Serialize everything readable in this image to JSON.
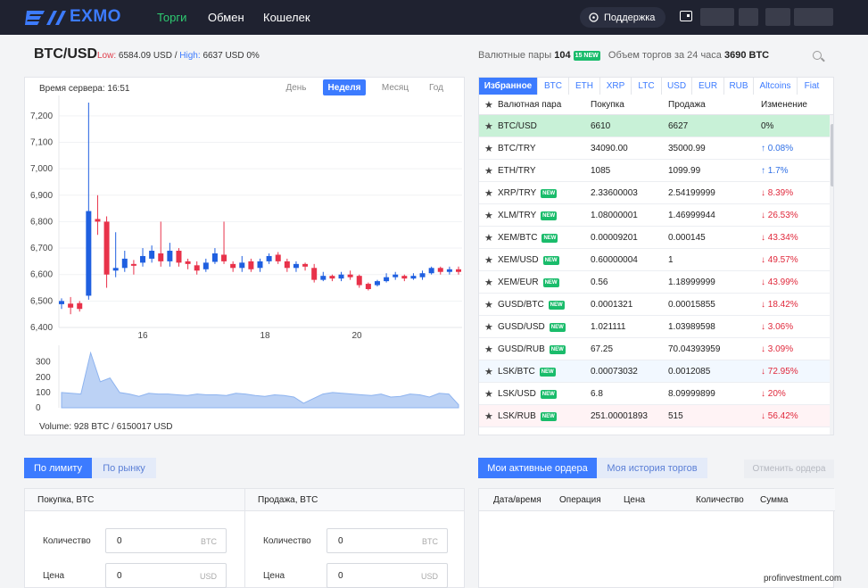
{
  "header": {
    "logo_text": "EXMO",
    "nav": [
      "Торги",
      "Обмен",
      "Кошелек"
    ],
    "support_label": "Поддержка"
  },
  "pair": {
    "title": "BTC/USD",
    "low_label": "Low:",
    "low_value": "6584.09 USD /",
    "high_label": "High:",
    "high_value": "6637 USD 0%"
  },
  "market": {
    "pairs_label": "Валютные пары",
    "pairs_count": "104",
    "new_badge": "15 NEW",
    "volume_label": "Объем торгов за 24 часа",
    "volume_value": "3690 BTC"
  },
  "chart": {
    "server_time": "Время сервера: 16:51",
    "ranges": [
      "День",
      "Неделя",
      "Месяц",
      "Год"
    ],
    "active_range": "Неделя",
    "volume_text": "Volume: 928 BTC / 6150017 USD"
  },
  "chart_data": {
    "type": "candlestick",
    "title": "",
    "price_axis": {
      "ticks": [
        7200,
        7100,
        7000,
        6900,
        6800,
        6700,
        6600,
        6500,
        6400
      ],
      "range": [
        6400,
        7250
      ]
    },
    "x_ticks": [
      "16",
      "18",
      "20"
    ],
    "candles": [
      [
        6488,
        6500,
        6470,
        6510
      ],
      [
        6490,
        6475,
        6450,
        6515
      ],
      [
        6492,
        6470,
        6460,
        6500
      ],
      [
        6520,
        6840,
        6505,
        7250
      ],
      [
        6810,
        6800,
        6750,
        6900
      ],
      [
        6800,
        6600,
        6550,
        6820
      ],
      [
        6615,
        6625,
        6590,
        6760
      ],
      [
        6625,
        6660,
        6610,
        6690
      ],
      [
        6640,
        6635,
        6600,
        6655
      ],
      [
        6645,
        6670,
        6630,
        6700
      ],
      [
        6660,
        6690,
        6645,
        6710
      ],
      [
        6680,
        6650,
        6630,
        6800
      ],
      [
        6650,
        6690,
        6630,
        6720
      ],
      [
        6690,
        6645,
        6630,
        6700
      ],
      [
        6650,
        6640,
        6620,
        6660
      ],
      [
        6635,
        6615,
        6600,
        6650
      ],
      [
        6620,
        6645,
        6610,
        6660
      ],
      [
        6648,
        6680,
        6640,
        6700
      ],
      [
        6675,
        6650,
        6640,
        6800
      ],
      [
        6640,
        6625,
        6610,
        6650
      ],
      [
        6625,
        6645,
        6610,
        6670
      ],
      [
        6650,
        6620,
        6610,
        6660
      ],
      [
        6625,
        6650,
        6610,
        6660
      ],
      [
        6650,
        6670,
        6640,
        6680
      ],
      [
        6675,
        6650,
        6640,
        6685
      ],
      [
        6650,
        6625,
        6610,
        6660
      ],
      [
        6625,
        6640,
        6610,
        6650
      ],
      [
        6640,
        6630,
        6615,
        6645
      ],
      [
        6625,
        6580,
        6570,
        6640
      ],
      [
        6580,
        6595,
        6575,
        6610
      ],
      [
        6595,
        6585,
        6575,
        6600
      ],
      [
        6585,
        6600,
        6575,
        6610
      ],
      [
        6600,
        6590,
        6580,
        6615
      ],
      [
        6595,
        6560,
        6550,
        6600
      ],
      [
        6565,
        6545,
        6540,
        6570
      ],
      [
        6560,
        6575,
        6555,
        6580
      ],
      [
        6575,
        6590,
        6570,
        6605
      ],
      [
        6590,
        6600,
        6580,
        6610
      ],
      [
        6595,
        6585,
        6575,
        6600
      ],
      [
        6585,
        6595,
        6580,
        6605
      ],
      [
        6590,
        6605,
        6580,
        6615
      ],
      [
        6605,
        6625,
        6600,
        6630
      ],
      [
        6625,
        6610,
        6600,
        6630
      ],
      [
        6610,
        6620,
        6600,
        6630
      ],
      [
        6620,
        6610,
        6600,
        6630
      ]
    ],
    "volume_axis": {
      "ticks": [
        300,
        200,
        100,
        0
      ],
      "range": [
        0,
        380
      ]
    },
    "volume_series": [
      100,
      95,
      90,
      360,
      170,
      195,
      100,
      90,
      75,
      95,
      90,
      90,
      85,
      80,
      90,
      85,
      85,
      80,
      95,
      90,
      80,
      75,
      85,
      80,
      70,
      30,
      60,
      90,
      100,
      95,
      90,
      85,
      80,
      90,
      70,
      75,
      90,
      85,
      70,
      95,
      90,
      20
    ],
    "colors": {
      "up": "#1f5fe0",
      "down": "#e8324a",
      "volume_fill": "#bcd2f5",
      "volume_line": "#8db3ef"
    }
  },
  "pairs": {
    "tabs": [
      "Избранное",
      "BTC",
      "ETH",
      "XRP",
      "LTC",
      "USD",
      "EUR",
      "RUB",
      "Altcoins",
      "Fiat"
    ],
    "active_tab": "Избранное",
    "columns": [
      "Валютная пара",
      "Покупка",
      "Продажа",
      "Изменение"
    ],
    "new_tag": "NEW",
    "rows": [
      {
        "pair": "BTC/USD",
        "new": false,
        "buy": "6610",
        "sell": "6627",
        "change": "0%",
        "dir": "flat",
        "bg": "selected"
      },
      {
        "pair": "BTC/TRY",
        "new": false,
        "buy": "34090.00",
        "sell": "35000.99",
        "change": "↑ 0.08%",
        "dir": "up",
        "bg": ""
      },
      {
        "pair": "ETH/TRY",
        "new": false,
        "buy": "1085",
        "sell": "1099.99",
        "change": "↑ 1.7%",
        "dir": "up",
        "bg": ""
      },
      {
        "pair": "XRP/TRY",
        "new": true,
        "buy": "2.33600003",
        "sell": "2.54199999",
        "change": "↓ 8.39%",
        "dir": "down",
        "bg": ""
      },
      {
        "pair": "XLM/TRY",
        "new": true,
        "buy": "1.08000001",
        "sell": "1.46999944",
        "change": "↓ 26.53%",
        "dir": "down",
        "bg": ""
      },
      {
        "pair": "XEM/BTC",
        "new": true,
        "buy": "0.00009201",
        "sell": "0.000145",
        "change": "↓ 43.34%",
        "dir": "down",
        "bg": ""
      },
      {
        "pair": "XEM/USD",
        "new": true,
        "buy": "0.60000004",
        "sell": "1",
        "change": "↓ 49.57%",
        "dir": "down",
        "bg": ""
      },
      {
        "pair": "XEM/EUR",
        "new": true,
        "buy": "0.56",
        "sell": "1.18999999",
        "change": "↓ 43.99%",
        "dir": "down",
        "bg": ""
      },
      {
        "pair": "GUSD/BTC",
        "new": true,
        "buy": "0.0001321",
        "sell": "0.00015855",
        "change": "↓ 18.42%",
        "dir": "down",
        "bg": ""
      },
      {
        "pair": "GUSD/USD",
        "new": true,
        "buy": "1.021111",
        "sell": "1.03989598",
        "change": "↓ 3.06%",
        "dir": "down",
        "bg": ""
      },
      {
        "pair": "GUSD/RUB",
        "new": true,
        "buy": "67.25",
        "sell": "70.04393959",
        "change": "↓ 3.09%",
        "dir": "down",
        "bg": ""
      },
      {
        "pair": "LSK/BTC",
        "new": true,
        "buy": "0.00073032",
        "sell": "0.0012085",
        "change": "↓ 72.95%",
        "dir": "down",
        "bg": "hl-blue"
      },
      {
        "pair": "LSK/USD",
        "new": true,
        "buy": "6.8",
        "sell": "8.09999899",
        "change": "↓ 20%",
        "dir": "down",
        "bg": ""
      },
      {
        "pair": "LSK/RUB",
        "new": true,
        "buy": "251.00001893",
        "sell": "515",
        "change": "↓ 56.42%",
        "dir": "down",
        "bg": "hl-red"
      }
    ]
  },
  "order_form": {
    "tabs": [
      "По лимиту",
      "По рынку"
    ],
    "buy_title": "Покупка, BTC",
    "sell_title": "Продажа, BTC",
    "quantity_label": "Количество",
    "price_label": "Цена",
    "quantity_value": "0",
    "price_value": "0",
    "quantity_unit": "BTC",
    "price_unit": "USD"
  },
  "orders": {
    "tabs": [
      "Мои активные ордера",
      "Моя история торгов"
    ],
    "cancel_label": "Отменить ордера",
    "columns": [
      "Дата/время",
      "Операция",
      "Цена",
      "Количество",
      "Сумма"
    ]
  },
  "watermark": "profinvestment.com"
}
